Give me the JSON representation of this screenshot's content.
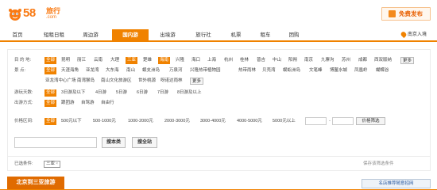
{
  "header": {
    "logo_text": "58.com",
    "logo_number": "58",
    "logo_sub": "旅行",
    "logo_domain": ".com",
    "publish_label": "免费发布"
  },
  "nav": {
    "items": [
      "首页",
      "短租日租",
      "周边游",
      "国内游",
      "出境游",
      "旅行社",
      "机票",
      "租车",
      "团购"
    ],
    "active": "国内游",
    "location": "南京入境"
  },
  "filters": {
    "destination": {
      "label": "目 的 地:",
      "options": [
        "全部",
        "昆明",
        "丽江",
        "云南",
        "大理",
        "三亚",
        "楚雄",
        "海南",
        "兴隆",
        "海口",
        "上海",
        "杭州",
        "桂林",
        "普吉",
        "中山",
        "阳朔",
        "南京",
        "九寨沟",
        "苏州",
        "成都",
        "西双版纳"
      ],
      "selected": "三亚",
      "more": "更多"
    },
    "scenic": {
      "label": "景    点:",
      "options_row1": [
        "全部",
        "天涯海角",
        "亚龙湾",
        "大东海",
        "南山",
        "蜈支洲岛",
        "万泉河",
        "兴隆热带植物园",
        "热带雨林",
        "贝壳湾",
        "蜈蚣洲岛",
        "文笔峰",
        "博鳌水城",
        "凤凰岭",
        "蝴蝶谷"
      ],
      "options_row2": [
        "亚龙湾中心广场",
        "南湾猴岛",
        "南山文化旅游区",
        "世外桃源",
        "呀诺达雨林"
      ],
      "selected": "全部",
      "more": "更多"
    },
    "days": {
      "label": "游玩天数:",
      "options": [
        "全部",
        "3日游及以下",
        "4日游",
        "5日游",
        "6日游",
        "7日游",
        "8日游及以上"
      ],
      "selected": "全部"
    },
    "departure": {
      "label": "出游方式:",
      "options": [
        "全部",
        "跟团游",
        "自驾游",
        "自由行"
      ],
      "selected": "全部"
    },
    "price": {
      "label": "价格区间:",
      "options": [
        "全部",
        "500元以下",
        "500-1000元",
        "1000-2000元",
        "2000-3000元",
        "3000-4000元",
        "4000-5000元",
        "5000元以上"
      ],
      "selected": "全部",
      "min_value": "",
      "max_value": "",
      "filter_button": "价格筛选"
    }
  },
  "search": {
    "value": "",
    "local_button": "搜本类",
    "all_button": "搜全站"
  },
  "selected_conditions": {
    "label": "已选条件:",
    "chip": "三亚",
    "chip_close": "×",
    "save_link": "保存该筛选条件"
  },
  "bottom": {
    "route_tab": "北京到三亚旅游",
    "recommend": "名店推荐随意招网"
  },
  "colors": {
    "accent": "#f08200",
    "brand": "#f97a13",
    "link_blue": "#2a5aa0"
  }
}
